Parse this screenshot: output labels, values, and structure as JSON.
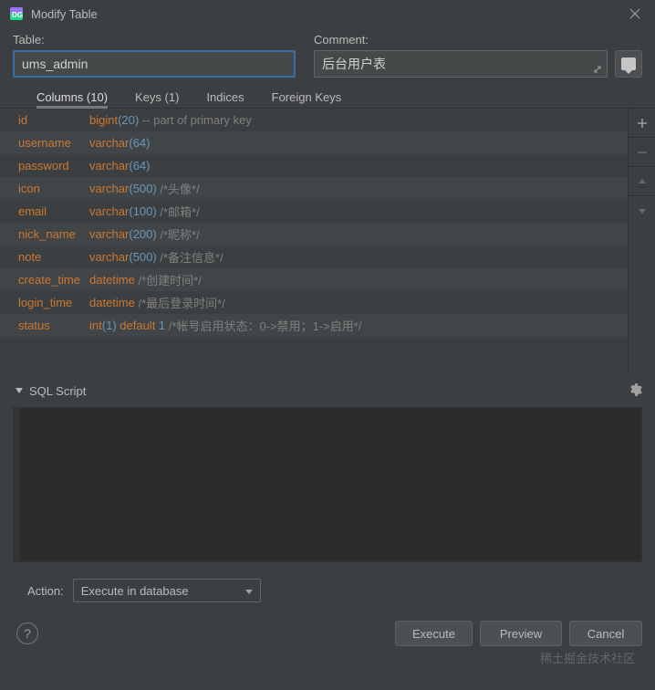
{
  "window": {
    "title": "Modify Table"
  },
  "labels": {
    "table": "Table:",
    "comment": "Comment:",
    "sql_script": "SQL Script",
    "action": "Action:"
  },
  "inputs": {
    "table_name": "ums_admin",
    "comment": "后台用户表",
    "action_select": "Execute in database"
  },
  "tabs": [
    {
      "label": "Columns (10)",
      "active": true
    },
    {
      "label": "Keys (1)",
      "active": false
    },
    {
      "label": "Indices",
      "active": false
    },
    {
      "label": "Foreign Keys",
      "active": false
    }
  ],
  "columns": [
    {
      "name": "id",
      "type": "bigint",
      "size": "20",
      "extra_kw": "",
      "comment": " -- part of primary key",
      "striped": false
    },
    {
      "name": "username",
      "type": "varchar",
      "size": "64",
      "extra_kw": "",
      "comment": "",
      "striped": true
    },
    {
      "name": "password",
      "type": "varchar",
      "size": "64",
      "extra_kw": "",
      "comment": "",
      "striped": false
    },
    {
      "name": "icon",
      "type": "varchar",
      "size": "500",
      "extra_kw": "",
      "comment": " /*头像*/",
      "striped": true
    },
    {
      "name": "email",
      "type": "varchar",
      "size": "100",
      "extra_kw": "",
      "comment": " /*邮箱*/",
      "striped": false
    },
    {
      "name": "nick_name",
      "type": "varchar",
      "size": "200",
      "extra_kw": "",
      "comment": " /*昵称*/",
      "striped": true
    },
    {
      "name": "note",
      "type": "varchar",
      "size": "500",
      "extra_kw": "",
      "comment": " /*备注信息*/",
      "striped": false
    },
    {
      "name": "create_time",
      "type": "datetime",
      "size": "",
      "extra_kw": "",
      "comment": " /*创建时间*/",
      "striped": true
    },
    {
      "name": "login_time",
      "type": "datetime",
      "size": "",
      "extra_kw": "",
      "comment": " /*最后登录时间*/",
      "striped": false
    },
    {
      "name": "status",
      "type": "int",
      "size": "1",
      "extra_kw": " default 1",
      "comment": " /*帐号启用状态：0->禁用；1->启用*/",
      "striped": true
    }
  ],
  "buttons": {
    "execute": "Execute",
    "preview": "Preview",
    "cancel": "Cancel",
    "help": "?"
  },
  "watermark": "稀土掘金技术社区"
}
